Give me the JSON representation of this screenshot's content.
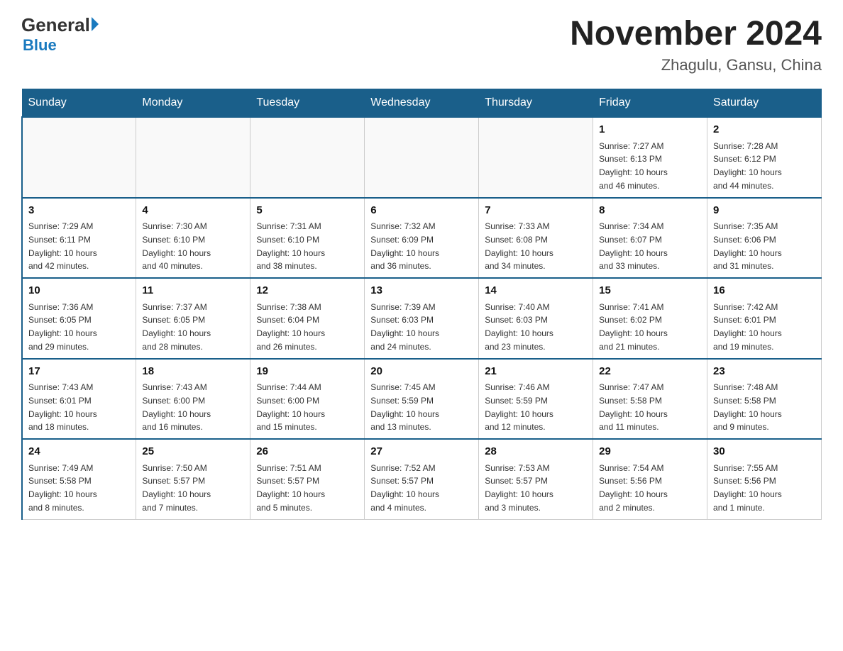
{
  "header": {
    "logo_general": "General",
    "logo_blue": "Blue",
    "title": "November 2024",
    "location": "Zhagulu, Gansu, China"
  },
  "weekdays": [
    "Sunday",
    "Monday",
    "Tuesday",
    "Wednesday",
    "Thursday",
    "Friday",
    "Saturday"
  ],
  "weeks": [
    [
      {
        "day": "",
        "info": ""
      },
      {
        "day": "",
        "info": ""
      },
      {
        "day": "",
        "info": ""
      },
      {
        "day": "",
        "info": ""
      },
      {
        "day": "",
        "info": ""
      },
      {
        "day": "1",
        "info": "Sunrise: 7:27 AM\nSunset: 6:13 PM\nDaylight: 10 hours\nand 46 minutes."
      },
      {
        "day": "2",
        "info": "Sunrise: 7:28 AM\nSunset: 6:12 PM\nDaylight: 10 hours\nand 44 minutes."
      }
    ],
    [
      {
        "day": "3",
        "info": "Sunrise: 7:29 AM\nSunset: 6:11 PM\nDaylight: 10 hours\nand 42 minutes."
      },
      {
        "day": "4",
        "info": "Sunrise: 7:30 AM\nSunset: 6:10 PM\nDaylight: 10 hours\nand 40 minutes."
      },
      {
        "day": "5",
        "info": "Sunrise: 7:31 AM\nSunset: 6:10 PM\nDaylight: 10 hours\nand 38 minutes."
      },
      {
        "day": "6",
        "info": "Sunrise: 7:32 AM\nSunset: 6:09 PM\nDaylight: 10 hours\nand 36 minutes."
      },
      {
        "day": "7",
        "info": "Sunrise: 7:33 AM\nSunset: 6:08 PM\nDaylight: 10 hours\nand 34 minutes."
      },
      {
        "day": "8",
        "info": "Sunrise: 7:34 AM\nSunset: 6:07 PM\nDaylight: 10 hours\nand 33 minutes."
      },
      {
        "day": "9",
        "info": "Sunrise: 7:35 AM\nSunset: 6:06 PM\nDaylight: 10 hours\nand 31 minutes."
      }
    ],
    [
      {
        "day": "10",
        "info": "Sunrise: 7:36 AM\nSunset: 6:05 PM\nDaylight: 10 hours\nand 29 minutes."
      },
      {
        "day": "11",
        "info": "Sunrise: 7:37 AM\nSunset: 6:05 PM\nDaylight: 10 hours\nand 28 minutes."
      },
      {
        "day": "12",
        "info": "Sunrise: 7:38 AM\nSunset: 6:04 PM\nDaylight: 10 hours\nand 26 minutes."
      },
      {
        "day": "13",
        "info": "Sunrise: 7:39 AM\nSunset: 6:03 PM\nDaylight: 10 hours\nand 24 minutes."
      },
      {
        "day": "14",
        "info": "Sunrise: 7:40 AM\nSunset: 6:03 PM\nDaylight: 10 hours\nand 23 minutes."
      },
      {
        "day": "15",
        "info": "Sunrise: 7:41 AM\nSunset: 6:02 PM\nDaylight: 10 hours\nand 21 minutes."
      },
      {
        "day": "16",
        "info": "Sunrise: 7:42 AM\nSunset: 6:01 PM\nDaylight: 10 hours\nand 19 minutes."
      }
    ],
    [
      {
        "day": "17",
        "info": "Sunrise: 7:43 AM\nSunset: 6:01 PM\nDaylight: 10 hours\nand 18 minutes."
      },
      {
        "day": "18",
        "info": "Sunrise: 7:43 AM\nSunset: 6:00 PM\nDaylight: 10 hours\nand 16 minutes."
      },
      {
        "day": "19",
        "info": "Sunrise: 7:44 AM\nSunset: 6:00 PM\nDaylight: 10 hours\nand 15 minutes."
      },
      {
        "day": "20",
        "info": "Sunrise: 7:45 AM\nSunset: 5:59 PM\nDaylight: 10 hours\nand 13 minutes."
      },
      {
        "day": "21",
        "info": "Sunrise: 7:46 AM\nSunset: 5:59 PM\nDaylight: 10 hours\nand 12 minutes."
      },
      {
        "day": "22",
        "info": "Sunrise: 7:47 AM\nSunset: 5:58 PM\nDaylight: 10 hours\nand 11 minutes."
      },
      {
        "day": "23",
        "info": "Sunrise: 7:48 AM\nSunset: 5:58 PM\nDaylight: 10 hours\nand 9 minutes."
      }
    ],
    [
      {
        "day": "24",
        "info": "Sunrise: 7:49 AM\nSunset: 5:58 PM\nDaylight: 10 hours\nand 8 minutes."
      },
      {
        "day": "25",
        "info": "Sunrise: 7:50 AM\nSunset: 5:57 PM\nDaylight: 10 hours\nand 7 minutes."
      },
      {
        "day": "26",
        "info": "Sunrise: 7:51 AM\nSunset: 5:57 PM\nDaylight: 10 hours\nand 5 minutes."
      },
      {
        "day": "27",
        "info": "Sunrise: 7:52 AM\nSunset: 5:57 PM\nDaylight: 10 hours\nand 4 minutes."
      },
      {
        "day": "28",
        "info": "Sunrise: 7:53 AM\nSunset: 5:57 PM\nDaylight: 10 hours\nand 3 minutes."
      },
      {
        "day": "29",
        "info": "Sunrise: 7:54 AM\nSunset: 5:56 PM\nDaylight: 10 hours\nand 2 minutes."
      },
      {
        "day": "30",
        "info": "Sunrise: 7:55 AM\nSunset: 5:56 PM\nDaylight: 10 hours\nand 1 minute."
      }
    ]
  ]
}
